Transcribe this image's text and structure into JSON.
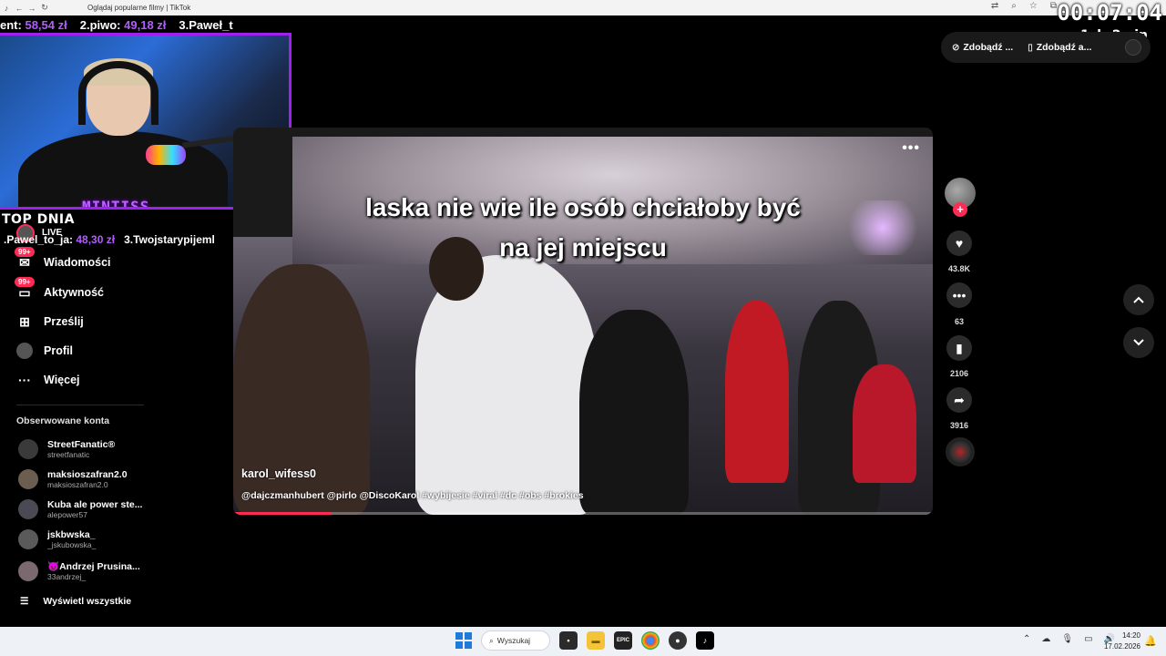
{
  "browser": {
    "tab_title": "Oglądaj popularne filmy | TikTok",
    "nav_icons": [
      "back-icon",
      "forward-icon",
      "reload-icon"
    ],
    "right_icons": [
      "translate-icon",
      "zoom-icon",
      "star-icon",
      "extensions-icon"
    ]
  },
  "overlay": {
    "timer": "00:07:04",
    "timer_rule": "1zł=2min",
    "donations_top": [
      {
        "label": "ent:",
        "amount": "58,54 zł"
      },
      {
        "label": "2.piwo:",
        "amount": "49,18 zł"
      },
      {
        "label": "3.Paweł_t",
        "amount": ""
      }
    ],
    "webcam_name": "MINTISS",
    "top_dnia_title": "TOP DNIA",
    "top_dnia_line": [
      {
        "label": ".Pawel_to_ja:",
        "amount": "48,30 zł"
      },
      {
        "label": "3.Twojstarypijeml",
        "amount": ""
      }
    ],
    "accent_color": "#b25cff"
  },
  "sidebar": {
    "live_label": "LIVE",
    "nav": [
      {
        "label": "Wiadomości",
        "icon": "message-icon",
        "badge": "99+"
      },
      {
        "label": "Aktywność",
        "icon": "inbox-icon",
        "badge": "99+"
      },
      {
        "label": "Prześlij",
        "icon": "upload-icon",
        "badge": ""
      },
      {
        "label": "Profil",
        "icon": "profile-icon",
        "badge": ""
      },
      {
        "label": "Więcej",
        "icon": "more-icon",
        "badge": ""
      }
    ],
    "followed_title": "Obserwowane konta",
    "followed": [
      {
        "name": "StreetFanatic®",
        "handle": "streetfanatic"
      },
      {
        "name": "maksioszafran2.0",
        "handle": "maksioszafran2.0"
      },
      {
        "name": "Kuba ale power ste...",
        "handle": "alepower57"
      },
      {
        "name": "jskbwska_",
        "handle": "_jskubowska_"
      },
      {
        "name": "👿Andrzej Prusina...",
        "handle": "33andrzej_"
      }
    ],
    "show_all": "Wyświetl wszystkie"
  },
  "top_buttons": [
    {
      "label": "Zdobądź ...",
      "icon": "coin-icon"
    },
    {
      "label": "Zdobądź a...",
      "icon": "phone-icon"
    }
  ],
  "video": {
    "caption_line1": "laska nie wie ile osób chciałoby być",
    "caption_line2": "na jej miejscu",
    "author": "karol_wifess0",
    "description": "@dajczmanhubert @pirlo @DiscoKarol #wybijesie #viral #dc #obs #brokies",
    "progress": 0.14,
    "progress_color": "#fe2c55"
  },
  "actions": {
    "likes": "43.8K",
    "comments": "63",
    "saves": "2106",
    "shares": "3916"
  },
  "taskbar": {
    "search_label": "Wyszukaj",
    "time": "14:20",
    "date": "17.02.2026"
  }
}
